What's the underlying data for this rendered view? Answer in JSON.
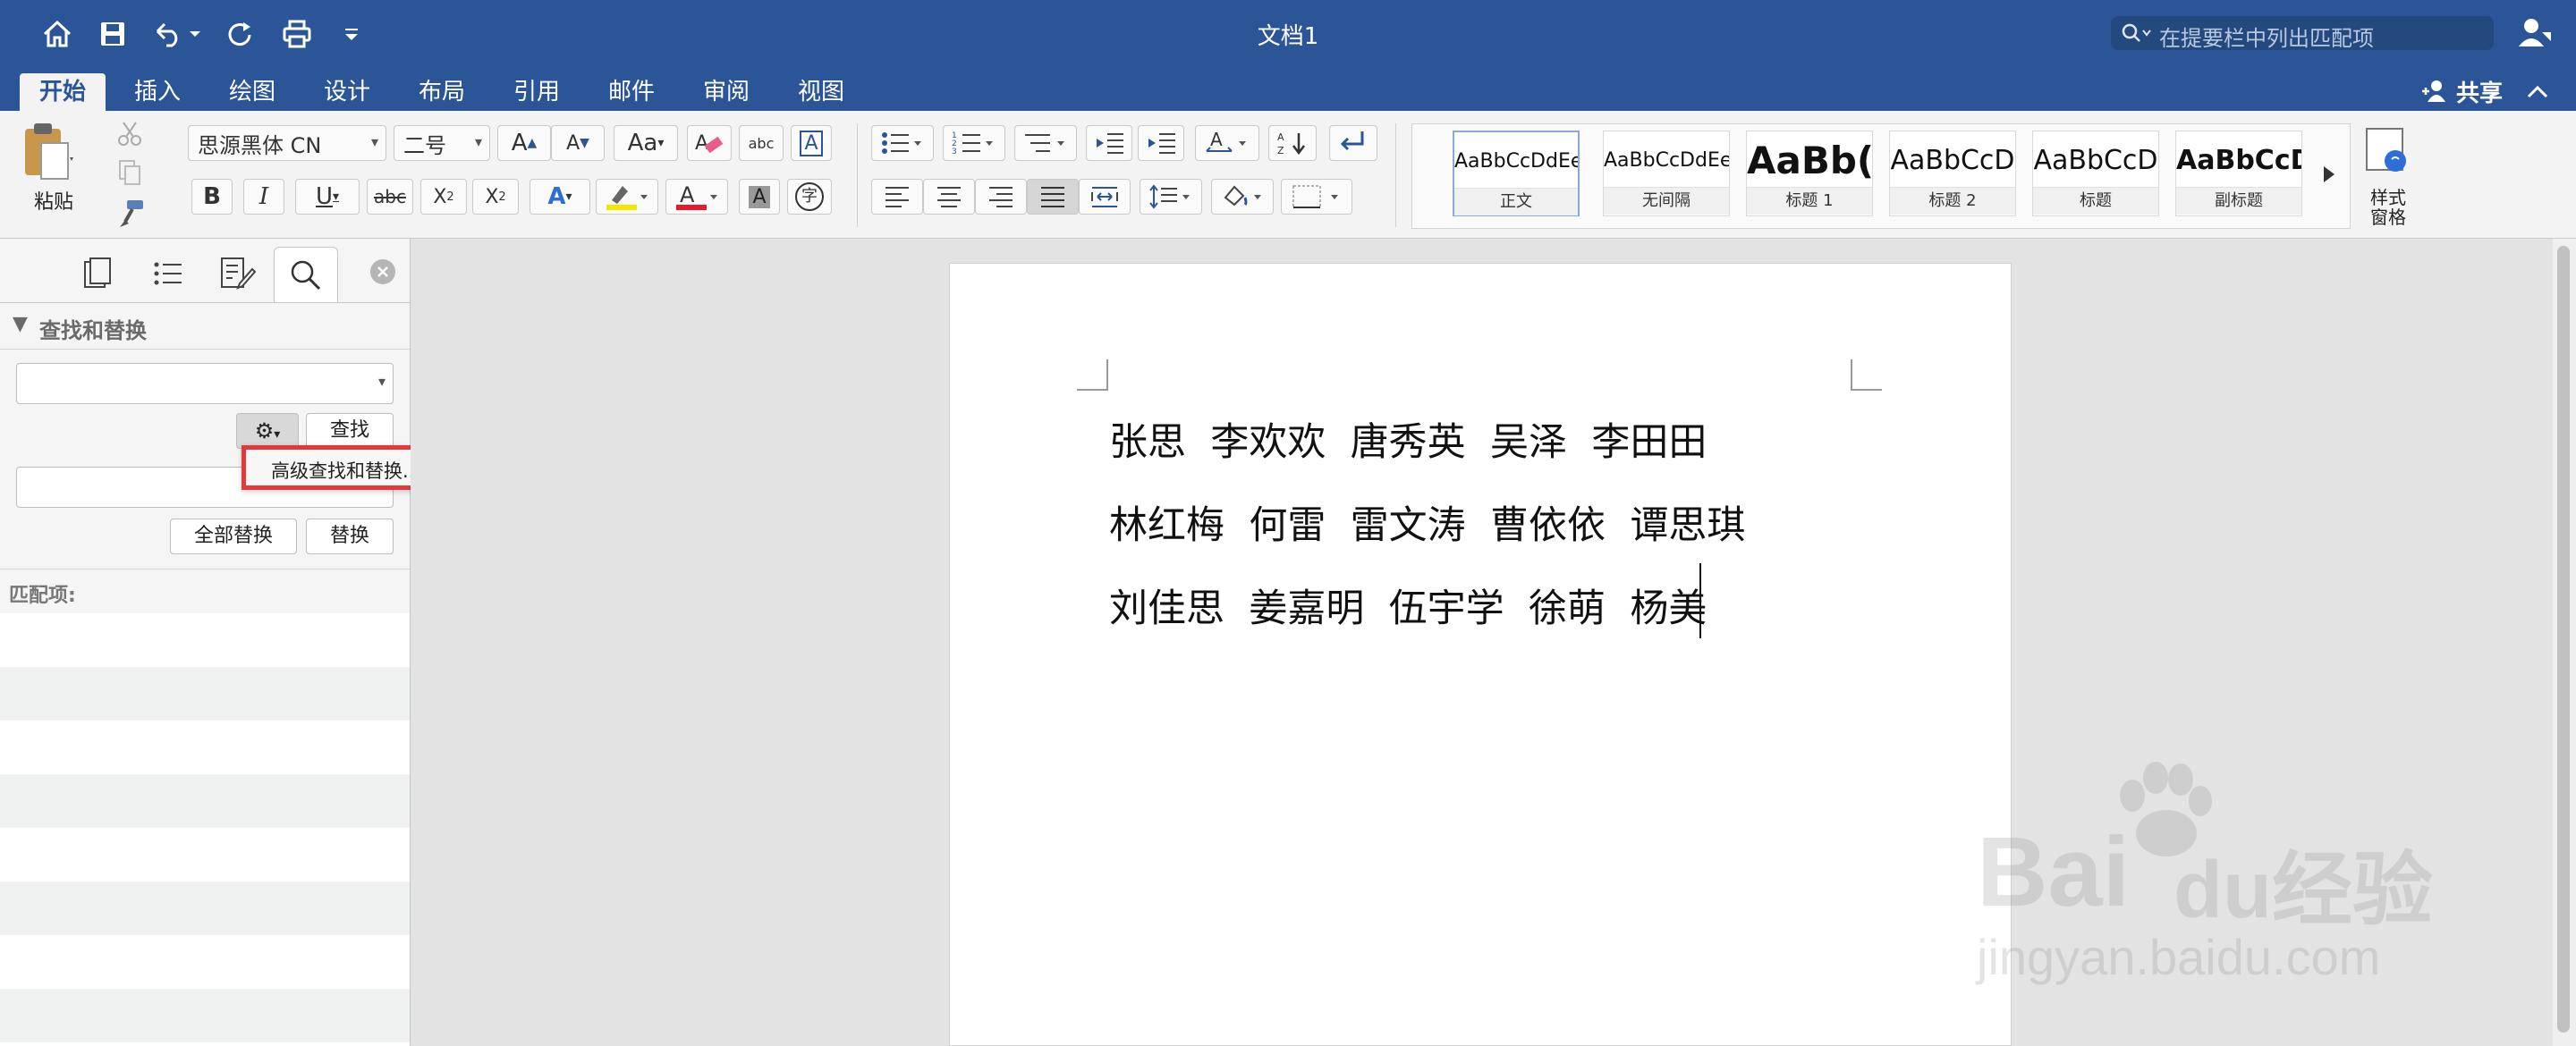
{
  "window": {
    "title": "文档1"
  },
  "search": {
    "placeholder": "在提要栏中列出匹配项"
  },
  "tabs": [
    "开始",
    "插入",
    "绘图",
    "设计",
    "布局",
    "引用",
    "邮件",
    "审阅",
    "视图"
  ],
  "share_label": "共享",
  "ribbon": {
    "paste_label": "粘贴",
    "font_name": "思源黑体 CN",
    "font_size": "二号",
    "styles": [
      {
        "sample": "AaBbCcDdEe",
        "name": "正文"
      },
      {
        "sample": "AaBbCcDdEe",
        "name": "无间隔"
      },
      {
        "sample": "AaBb(",
        "name": "标题 1"
      },
      {
        "sample": "AaBbCcD",
        "name": "标题 2"
      },
      {
        "sample": "AaBbCcD",
        "name": "标题"
      },
      {
        "sample": "AaBbCcD",
        "name": "副标题"
      }
    ],
    "style_pane_label": "样式\n窗格",
    "bold": "B",
    "italic": "I",
    "underline": "U",
    "strike": "abc",
    "sub": "X2",
    "sup": "X2"
  },
  "pane": {
    "section_title": "查找和替换",
    "find_value": "",
    "find_button": "查找",
    "replace_value": "",
    "replace_all_button": "全部替换",
    "replace_button": "替换",
    "matches_label": "匹配项:",
    "menu_item": "高级查找和替换..."
  },
  "document": {
    "lines": [
      "张思  李欢欢  唐秀英  吴泽  李田田",
      "林红梅  何雷  雷文涛  曹依依  谭思琪",
      "刘佳思  姜嘉明  伍宇学  徐萌  杨美"
    ]
  },
  "watermark": {
    "brand": "Bai",
    "brand2": "经验",
    "url": "jingyan.baidu.com"
  },
  "colors": {
    "titlebar": "#2c5597",
    "highlight_box": "#e23a3a",
    "arrow": "#e8192c"
  }
}
